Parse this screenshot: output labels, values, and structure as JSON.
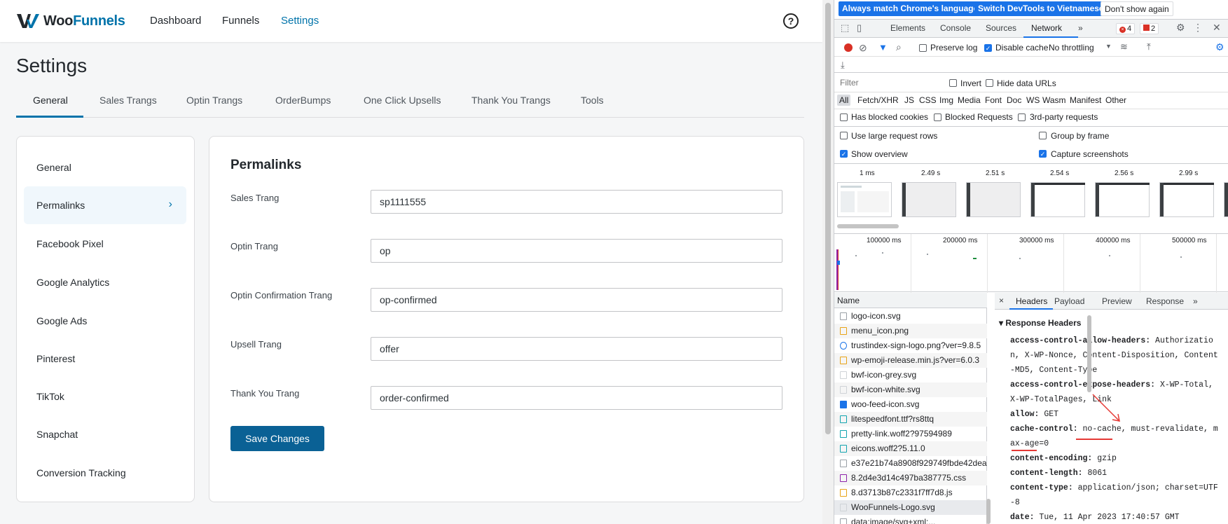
{
  "app": {
    "logo": {
      "part1": "Woo",
      "part2": "Funnels"
    },
    "nav": [
      "Dashboard",
      "Funnels",
      "Settings"
    ],
    "help": "?",
    "page_title": "Settings",
    "tabs": [
      "General",
      "Sales Trangs",
      "Optin Trangs",
      "OrderBumps",
      "One Click Upsells",
      "Thank You Trangs",
      "Tools"
    ],
    "sidebar": [
      "General",
      "Permalinks",
      "Facebook Pixel",
      "Google Analytics",
      "Google Ads",
      "Pinterest",
      "TikTok",
      "Snapchat",
      "Conversion Tracking"
    ],
    "sidebar_chevron": "›",
    "section_title": "Permalinks",
    "fields": [
      {
        "label": "Sales Trang",
        "value": "sp1111555"
      },
      {
        "label": "Optin Trang",
        "value": "op"
      },
      {
        "label": "Optin Confirmation Trang",
        "value": "op-confirmed"
      },
      {
        "label": "Upsell Trang",
        "value": "offer"
      },
      {
        "label": "Thank You Trang",
        "value": "order-confirmed"
      }
    ],
    "save_label": "Save Changes",
    "accent": "#0073aa"
  },
  "devtools": {
    "infobar": {
      "btn1": "Always match Chrome's language",
      "btn2": "Switch DevTools to Vietnamese",
      "btn3": "Don't show again"
    },
    "tabs": [
      "Elements",
      "Console",
      "Sources",
      "Network"
    ],
    "more": "»",
    "errors": "4",
    "warnings": "2",
    "toolbar": {
      "preserve_log": "Preserve log",
      "disable_cache": "Disable cache",
      "throttling": "No throttling"
    },
    "filter": {
      "placeholder": "Filter",
      "invert": "Invert",
      "hide_data_urls": "Hide data URLs"
    },
    "types": [
      "All",
      "Fetch/XHR",
      "JS",
      "CSS",
      "Img",
      "Media",
      "Font",
      "Doc",
      "WS",
      "Wasm",
      "Manifest",
      "Other"
    ],
    "blocked": {
      "has_blocked_cookies": "Has blocked cookies",
      "blocked_requests": "Blocked Requests",
      "third_party": "3rd-party requests"
    },
    "options": {
      "large_rows": "Use large request rows",
      "group_by_frame": "Group by frame",
      "show_overview": "Show overview",
      "capture_screenshots": "Capture screenshots"
    },
    "screenshot_times": [
      "1 ms",
      "2.49 s",
      "2.51 s",
      "2.54 s",
      "2.56 s",
      "2.99 s"
    ],
    "timeline_labels": [
      "100000 ms",
      "200000 ms",
      "300000 ms",
      "400000 ms",
      "500000 ms"
    ],
    "name_header": "Name",
    "requests": [
      "logo-icon.svg",
      "menu_icon.png",
      "trustindex-sign-logo.png?ver=9.8.5",
      "wp-emoji-release.min.js?ver=6.0.3",
      "bwf-icon-grey.svg",
      "bwf-icon-white.svg",
      "woo-feed-icon.svg",
      "litespeedfont.ttf?rs8ttq",
      "pretty-link.woff2?97594989",
      "eicons.woff2?5.11.0",
      "e37e21b74a8908f929749fbde42dea",
      "8.2d4e3d14c497ba387775.css",
      "8.d3713b87c2331f7ff7d8.js",
      "WooFunnels-Logo.svg",
      "data:image/svg+xml;..."
    ],
    "detail_tabs": [
      "Headers",
      "Payload",
      "Preview",
      "Response"
    ],
    "close": "×",
    "response_headers_title": "Response Headers",
    "headers": [
      {
        "k": "access-control-allow-headers:",
        "v": "Authorization, X-WP-Nonce, Content-Disposition, Content-MD5, Content-Type"
      },
      {
        "k": "access-control-expose-headers:",
        "v": "X-WP-Total, X-WP-TotalPages, Link"
      },
      {
        "k": "allow:",
        "v": "GET"
      },
      {
        "k": "cache-control:",
        "v": "no-cache, must-revalidate, max-age=0"
      },
      {
        "k": "content-encoding:",
        "v": "gzip"
      },
      {
        "k": "content-length:",
        "v": "8061"
      },
      {
        "k": "content-type:",
        "v": "application/json; charset=UTF-8"
      },
      {
        "k": "date:",
        "v": "Tue, 11 Apr 2023 17:40:57 GMT"
      }
    ]
  }
}
